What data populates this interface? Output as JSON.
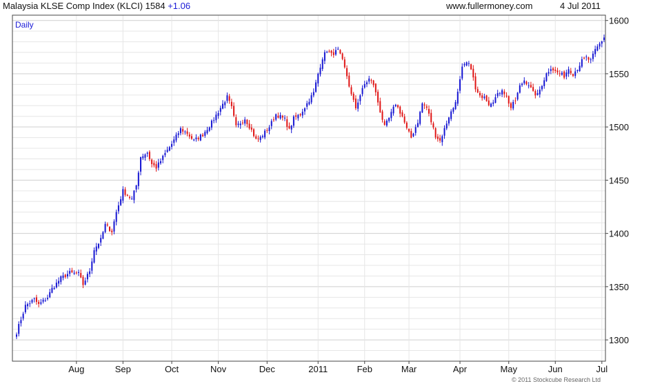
{
  "header": {
    "title": "Malaysia KLSE Comp Index (KLCI)",
    "last": "1584",
    "change": "+1.06",
    "site": "www.fullermoney.com",
    "date": "4 Jul 2011"
  },
  "footer": {
    "copyright": "© 2011 Stockcube Research Ltd"
  },
  "colors": {
    "up": "#1414d2",
    "down": "#e01414",
    "grid": "#cfcfcf",
    "minor_grid": "#e6e6e6"
  },
  "chart_data": {
    "type": "candlestick",
    "period_label": "Daily",
    "y_axis": {
      "position": "right",
      "ylim": [
        1280,
        1605
      ],
      "ticks": [
        1300,
        1350,
        1400,
        1450,
        1500,
        1550,
        1600
      ]
    },
    "x_axis": {
      "ticks": [
        {
          "label": "Aug",
          "index": 27
        },
        {
          "label": "Sep",
          "index": 48
        },
        {
          "label": "Oct",
          "index": 70
        },
        {
          "label": "Nov",
          "index": 91
        },
        {
          "label": "Dec",
          "index": 113
        },
        {
          "label": "2011",
          "index": 136
        },
        {
          "label": "Feb",
          "index": 157
        },
        {
          "label": "Mar",
          "index": 177
        },
        {
          "label": "Apr",
          "index": 200
        },
        {
          "label": "May",
          "index": 222
        },
        {
          "label": "Jun",
          "index": 243
        },
        {
          "label": "Jul",
          "index": 264
        }
      ]
    },
    "grid": true,
    "num_candles": 266,
    "anchors": [
      [
        0,
        1307
      ],
      [
        4,
        1332
      ],
      [
        8,
        1338
      ],
      [
        10,
        1333
      ],
      [
        14,
        1340
      ],
      [
        16,
        1348
      ],
      [
        20,
        1358
      ],
      [
        24,
        1363
      ],
      [
        28,
        1362
      ],
      [
        30,
        1352
      ],
      [
        33,
        1365
      ],
      [
        35,
        1385
      ],
      [
        38,
        1394
      ],
      [
        40,
        1408
      ],
      [
        43,
        1402
      ],
      [
        45,
        1420
      ],
      [
        48,
        1440
      ],
      [
        50,
        1436
      ],
      [
        52,
        1432
      ],
      [
        54,
        1445
      ],
      [
        56,
        1472
      ],
      [
        59,
        1476
      ],
      [
        61,
        1465
      ],
      [
        63,
        1462
      ],
      [
        65,
        1468
      ],
      [
        67,
        1475
      ],
      [
        70,
        1484
      ],
      [
        74,
        1498
      ],
      [
        77,
        1494
      ],
      [
        80,
        1487
      ],
      [
        84,
        1493
      ],
      [
        88,
        1504
      ],
      [
        92,
        1518
      ],
      [
        95,
        1528
      ],
      [
        97,
        1518
      ],
      [
        99,
        1500
      ],
      [
        103,
        1508
      ],
      [
        106,
        1497
      ],
      [
        108,
        1488
      ],
      [
        110,
        1490
      ],
      [
        114,
        1500
      ],
      [
        117,
        1512
      ],
      [
        121,
        1507
      ],
      [
        123,
        1497
      ],
      [
        125,
        1508
      ],
      [
        128,
        1512
      ],
      [
        131,
        1522
      ],
      [
        134,
        1532
      ],
      [
        136,
        1550
      ],
      [
        138,
        1565
      ],
      [
        140,
        1572
      ],
      [
        142,
        1568
      ],
      [
        145,
        1572
      ],
      [
        147,
        1562
      ],
      [
        149,
        1548
      ],
      [
        151,
        1530
      ],
      [
        153,
        1518
      ],
      [
        155,
        1530
      ],
      [
        157,
        1540
      ],
      [
        159,
        1545
      ],
      [
        161,
        1540
      ],
      [
        164,
        1515
      ],
      [
        166,
        1500
      ],
      [
        168,
        1508
      ],
      [
        171,
        1522
      ],
      [
        174,
        1510
      ],
      [
        176,
        1498
      ],
      [
        178,
        1490
      ],
      [
        181,
        1505
      ],
      [
        183,
        1522
      ],
      [
        185,
        1518
      ],
      [
        187,
        1505
      ],
      [
        189,
        1492
      ],
      [
        191,
        1487
      ],
      [
        193,
        1498
      ],
      [
        195,
        1510
      ],
      [
        197,
        1518
      ],
      [
        199,
        1532
      ],
      [
        201,
        1555
      ],
      [
        203,
        1560
      ],
      [
        205,
        1556
      ],
      [
        207,
        1535
      ],
      [
        209,
        1528
      ],
      [
        211,
        1530
      ],
      [
        213,
        1522
      ],
      [
        215,
        1525
      ],
      [
        217,
        1530
      ],
      [
        219,
        1536
      ],
      [
        221,
        1528
      ],
      [
        223,
        1518
      ],
      [
        225,
        1525
      ],
      [
        227,
        1538
      ],
      [
        229,
        1544
      ],
      [
        231,
        1540
      ],
      [
        233,
        1532
      ],
      [
        235,
        1530
      ],
      [
        237,
        1540
      ],
      [
        239,
        1550
      ],
      [
        241,
        1556
      ],
      [
        243,
        1552
      ],
      [
        245,
        1550
      ],
      [
        247,
        1548
      ],
      [
        249,
        1555
      ],
      [
        251,
        1550
      ],
      [
        253,
        1555
      ],
      [
        255,
        1562
      ],
      [
        257,
        1565
      ],
      [
        259,
        1562
      ],
      [
        261,
        1572
      ],
      [
        263,
        1578
      ],
      [
        265,
        1584
      ]
    ],
    "last_close": 1584,
    "last_change": 1.06
  }
}
